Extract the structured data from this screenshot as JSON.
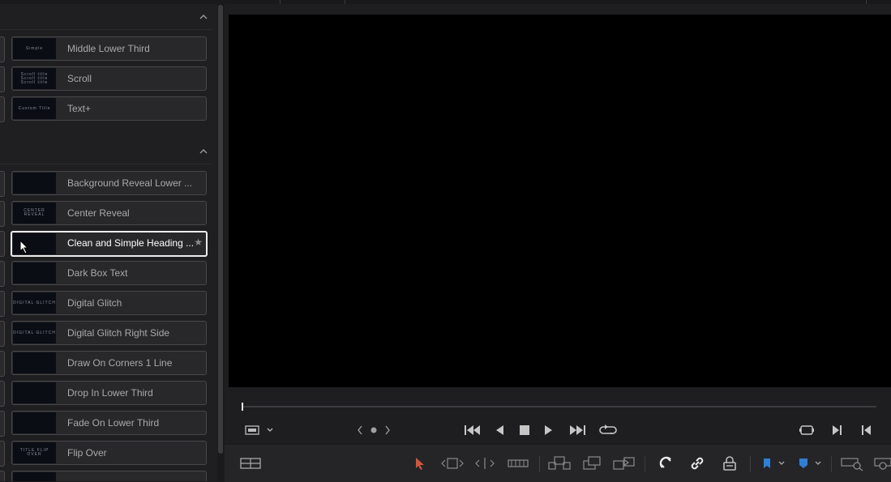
{
  "panel": {
    "sections": [
      {
        "items": [
          {
            "label": "Middle Lower Third",
            "thumb_text": "Simple"
          },
          {
            "label": "Scroll",
            "thumb_text": "Scroll title Scroll title Scroll title"
          },
          {
            "label": "Text+",
            "thumb_text": "Custom Title"
          }
        ]
      },
      {
        "items": [
          {
            "label": "Background Reveal Lower ...",
            "thumb_text": ""
          },
          {
            "label": "Center Reveal",
            "thumb_text": "CENTER REVEAL"
          },
          {
            "label": "Clean and Simple Heading ...",
            "thumb_text": "",
            "selected": true,
            "favorite": true
          },
          {
            "label": "Dark Box Text",
            "thumb_text": ""
          },
          {
            "label": "Digital Glitch",
            "thumb_text": "DIGITAL GLITCH"
          },
          {
            "label": "Digital Glitch Right Side",
            "thumb_text": "DIGITAL GLITCH"
          },
          {
            "label": "Draw On Corners 1 Line",
            "thumb_text": ""
          },
          {
            "label": "Drop In Lower Third",
            "thumb_text": ""
          },
          {
            "label": "Fade On Lower Third",
            "thumb_text": ""
          },
          {
            "label": "Flip Over",
            "thumb_text": "TITLE FLIP OVER"
          },
          {
            "label": "",
            "thumb_text": ""
          }
        ]
      }
    ]
  },
  "colors": {
    "accent_red": "#d2553b",
    "accent_blue": "#2f7fd8",
    "viewer_bg": "#000000",
    "panel_bg": "#1f1f21"
  },
  "icons": {
    "transport": [
      "go-to-start-icon",
      "play-reverse-icon",
      "stop-icon",
      "play-icon",
      "go-to-end-icon",
      "loop-icon"
    ],
    "toolbar": [
      "timeline-view-icon",
      "selection-arrow-icon",
      "trim-edit-icon",
      "dynamic-trim-icon",
      "blade-icon",
      "insert-clip-icon",
      "overwrite-clip-icon",
      "replace-clip-icon",
      "snapping-icon",
      "linked-selection-icon",
      "position-lock-icon",
      "flag-icon",
      "marker-icon",
      "zoom-icon"
    ]
  }
}
